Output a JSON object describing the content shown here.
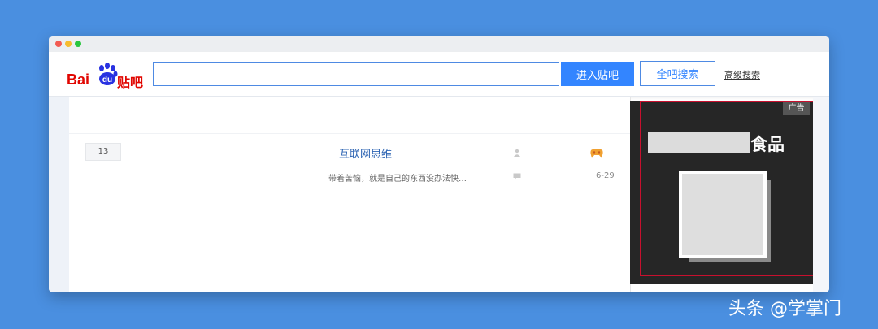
{
  "header": {
    "logo": {
      "bai": "Bai",
      "du": "du",
      "tieba": "贴吧"
    },
    "search": {
      "value": "",
      "placeholder": ""
    },
    "enter_button": "进入贴吧",
    "all_search_button": "全吧搜索",
    "advanced_search": "高级搜索"
  },
  "thread": {
    "reply_count": "13",
    "title": "互联网思维",
    "excerpt": "带着苦恼，就是自己的东西没办法快…",
    "date": "6-29"
  },
  "ad": {
    "tag": "广告",
    "title_suffix": "食品"
  },
  "watermark": "头条 @学掌门",
  "colors": {
    "background": "#4a8fe0",
    "brand_red": "#e10601",
    "accent_blue": "#3385ff",
    "highlight_red": "#c8102e"
  },
  "icons": [
    "baidu-paw-icon",
    "author-icon",
    "game-icon",
    "reply-icon"
  ]
}
